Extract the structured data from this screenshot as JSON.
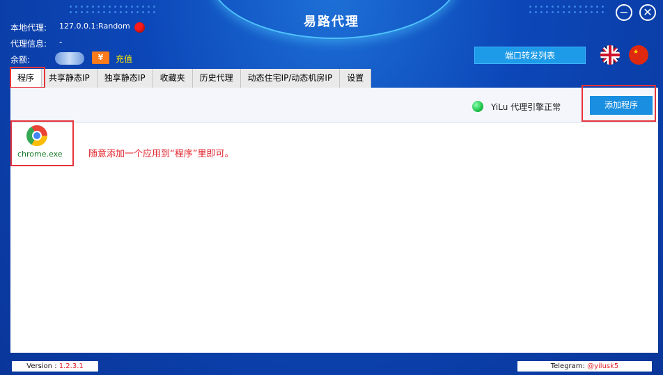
{
  "window": {
    "title": "易路代理",
    "minimize_icon": "minimize-icon",
    "close_icon": "close-icon"
  },
  "info": {
    "local_proxy_label": "本地代理:",
    "local_proxy_value": "127.0.0.1:Random",
    "proxy_info_label": "代理信息:",
    "proxy_info_value": "-",
    "balance_label": "余额:",
    "recharge_icon_text": "¥",
    "recharge_label": "充值",
    "status_color": "#ff1a1a"
  },
  "header": {
    "port_forward_button": "端口转发列表",
    "language_flags": [
      "uk-flag-icon",
      "cn-flag-icon"
    ]
  },
  "tabs": [
    {
      "label": "程序",
      "active": true
    },
    {
      "label": "共享静态IP",
      "active": false
    },
    {
      "label": "独享静态IP",
      "active": false
    },
    {
      "label": "收藏夹",
      "active": false
    },
    {
      "label": "历史代理",
      "active": false
    },
    {
      "label": "动态住宅IP/动态机房IP",
      "active": false
    },
    {
      "label": "设置",
      "active": false
    }
  ],
  "toolbar": {
    "engine_status": "YiLu 代理引擎正常",
    "add_program_button": "添加程序"
  },
  "programs": [
    {
      "name": "chrome.exe",
      "icon": "chrome-icon"
    }
  ],
  "hint": "随意添加一个应用到“程序”里即可。",
  "footer": {
    "version_label": "Version : ",
    "version_value": "1.2.3.1",
    "telegram_label": "Telegram: ",
    "telegram_value": "@yilusk5"
  },
  "colors": {
    "accent": "#1a8ee0",
    "highlight": "#e8333a",
    "recharge": "#ff7a1a",
    "online": "#1cc348"
  }
}
